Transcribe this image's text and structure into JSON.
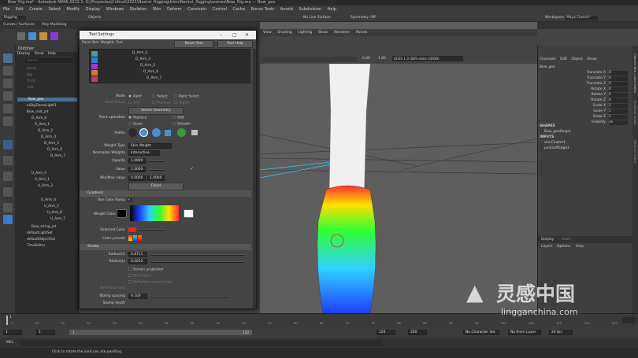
{
  "window": {
    "title": "Bow_Rig.ma* - Autodesk MAYA 2022.1: G:\\Proyectos\\Critical\\2021\\Nextut_Rigging\\Intro\\Nextut_Rigging\\scenes\\Bow_Rig.ma   ---   Bow_geo"
  },
  "menubar": [
    "File",
    "Edit",
    "Create",
    "Select",
    "Modify",
    "Display",
    "Windows",
    "Skeleton",
    "Skin",
    "Deform",
    "Constrain",
    "Control",
    "Cache",
    "Bonus Tools",
    "Arnold",
    "Subdivision",
    "Help"
  ],
  "status": {
    "menuset": "Rigging",
    "objects": "Objects",
    "surface": "No Live Surface",
    "symmetry": "Symmetry: Off",
    "workspace_label": "Workspace:",
    "workspace": "Maya Classic*",
    "user": "Abraham Leal"
  },
  "shelf": {
    "tabs": [
      "Curves / Surfaces",
      "Poly Modeling"
    ],
    "right_tabs": [
      "Effect",
      "MASH",
      "Motion Graphics",
      "Substance",
      "Nextut_Anim",
      "NT_Rigging"
    ],
    "icons": [
      "Mdr",
      "Pol",
      "Pbl",
      "Arg"
    ]
  },
  "outliner": {
    "title": "Outliner",
    "menu": [
      "Display",
      "Show",
      "Help"
    ],
    "search": "Search...",
    "items": [
      "persp",
      "top",
      "front",
      "side",
      "Bow_geo",
      "aiSkyDomeLight1",
      "Bow_root_jnt",
      "D_Arm_0",
      "D_Arm_1",
      "D_Arm_2",
      "D_Arm_4",
      "D_Arm_5",
      "D_Arm_6",
      "D_Arm_7",
      "U_Arm_0",
      "U_Arm_1",
      "U_Arm_2",
      "U_Arm_4",
      "U_Arm_5",
      "U_Arm_6",
      "U_Arm_7",
      "Bow_string_jnt",
      "defaultLightSet",
      "defaultObjectSet",
      "TimeEditor"
    ]
  },
  "dialog": {
    "title": "Tool Settings",
    "tool_name": "Paint Skin Weights Tool",
    "reset": "Reset Tool",
    "help": "Tool Help",
    "influences": [
      "D_Arm_3",
      "D_Arm_4",
      "D_Arm_5",
      "D_Arm_6",
      "D_Arm_7"
    ],
    "influence_colors": [
      "#3aa0a0",
      "#3a7ad0",
      "#9a3ad0",
      "#d07a3a",
      "#c03a6a"
    ],
    "mode_label": "Mode",
    "mode_options": [
      "Paint",
      "Select",
      "Paint Select"
    ],
    "paint_select_label": "Paint Select",
    "paint_select_options": [
      "Add",
      "Remove",
      "Toggle"
    ],
    "select_geometry": "Select Geometry",
    "paint_operation_label": "Paint operation",
    "paint_operation_options": [
      "Replace",
      "Add",
      "Scale",
      "Smooth"
    ],
    "profile_label": "Profile",
    "weight_type_label": "Weight Type",
    "weight_type": "Skin Weight",
    "normalize_label": "Normalize Weights",
    "normalize": "Interactive",
    "opacity_label": "Opacity",
    "opacity": "1.0000",
    "value_label": "Value",
    "value": "1.0000",
    "minmax_label": "Min/Max value",
    "min": "0.0000",
    "max": "1.0000",
    "flood": "Flood",
    "gradient_section": "Gradient",
    "use_color_ramp": "Use Color Ramp",
    "weight_color": "Weight Color",
    "selected_color": "Selected Color",
    "color_presets": "Color presets",
    "stroke_section": "Stroke",
    "radius_u_label": "Radius(U)",
    "radius_u": "0.6711",
    "radius_l_label": "Radius(L)",
    "radius_l": "0.0010",
    "screen_projection": "Screen projection",
    "reflection": "Reflection",
    "reflection_axis": "Reflection about origin",
    "reflection_axis_label": "Reflection axis",
    "stamp_spacing_label": "Stamp spacing",
    "stamp_spacing": "0.100",
    "stamp_depth_label": "Stamp depth"
  },
  "viewport": {
    "menu": [
      "View",
      "Shading",
      "Lighting",
      "Show",
      "Renderer",
      "Panels"
    ],
    "colorspace": "ACES 1.0 SDR-video (sRGB)",
    "gamma": "0.00",
    "exposure": "1.00"
  },
  "channel_box": {
    "menu": [
      "Channels",
      "Edit",
      "Object",
      "Show"
    ],
    "object": "Bow_geo",
    "attrs": [
      {
        "name": "Translate X",
        "value": "0"
      },
      {
        "name": "Translate Y",
        "value": "0"
      },
      {
        "name": "Translate Z",
        "value": "0"
      },
      {
        "name": "Rotate X",
        "value": "0"
      },
      {
        "name": "Rotate Y",
        "value": "0"
      },
      {
        "name": "Rotate Z",
        "value": "0"
      },
      {
        "name": "Scale X",
        "value": "1"
      },
      {
        "name": "Scale Y",
        "value": "1"
      },
      {
        "name": "Scale Z",
        "value": "1"
      },
      {
        "name": "Visibility",
        "value": "on"
      }
    ],
    "shapes_header": "SHAPES",
    "shape": "Bow_geoShape",
    "inputs_header": "INPUTS",
    "inputs": [
      "skinCluster1",
      "polySoftEdge1"
    ],
    "layer_tabs": [
      "Display",
      "Anim"
    ],
    "layer_menu": [
      "Layers",
      "Options",
      "Help"
    ],
    "side_tabs": [
      "Channel Box / Layer Editor",
      "Modeling Toolkit",
      "Attribute Editor"
    ]
  },
  "timeline": {
    "ticks": [
      "5",
      "10",
      "15",
      "20",
      "25",
      "30",
      "35",
      "40",
      "45",
      "50",
      "55",
      "60",
      "65",
      "70",
      "75",
      "80",
      "85",
      "90",
      "95",
      "100",
      "105",
      "110",
      "115",
      "120"
    ],
    "current": "1"
  },
  "range": {
    "start": "1",
    "inner_start": "1",
    "slider_label": "1",
    "inner_end": "120",
    "end": "120",
    "end2": "200",
    "character_set": "No Character Set",
    "anim_layer": "No Anim Layer",
    "fps": "24 fps"
  },
  "cmdline": {
    "label": "MEL"
  },
  "helpline": {
    "text": "Click to rotate the joint you are painting."
  },
  "watermark": {
    "cn": "灵感中国",
    "url": "lingganchina.com"
  }
}
